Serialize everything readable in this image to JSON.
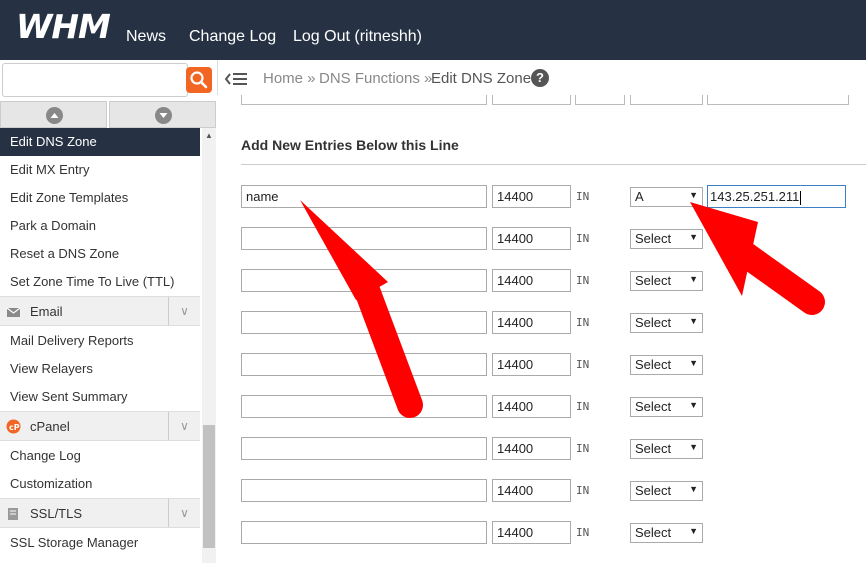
{
  "header": {
    "logo": "WHM",
    "nav": [
      "News",
      "Change Log",
      "Log Out (ritneshh)"
    ]
  },
  "search": {
    "placeholder": ""
  },
  "breadcrumb": [
    "Home »",
    "DNS Functions »",
    "Edit DNS Zone"
  ],
  "sidebar": {
    "dns_items": [
      "Edit DNS Zone",
      "Edit MX Entry",
      "Edit Zone Templates",
      "Park a Domain",
      "Reset a DNS Zone",
      "Set Zone Time To Live (TTL)"
    ],
    "email_header": "Email",
    "email_items": [
      "Mail Delivery Reports",
      "View Relayers",
      "View Sent Summary"
    ],
    "cpanel_header": "cPanel",
    "cpanel_items": [
      "Change Log",
      "Customization"
    ],
    "ssl_header": "SSL/TLS",
    "ssl_items": [
      "SSL Storage Manager"
    ]
  },
  "main": {
    "section_title": "Add New Entries Below this Line",
    "rows": [
      {
        "name": "name",
        "ttl": "14400",
        "class": "IN",
        "type": "A",
        "value": "143.25.251.211"
      },
      {
        "name": "",
        "ttl": "14400",
        "class": "IN",
        "type": "Select"
      },
      {
        "name": "",
        "ttl": "14400",
        "class": "IN",
        "type": "Select"
      },
      {
        "name": "",
        "ttl": "14400",
        "class": "IN",
        "type": "Select"
      },
      {
        "name": "",
        "ttl": "14400",
        "class": "IN",
        "type": "Select"
      },
      {
        "name": "",
        "ttl": "14400",
        "class": "IN",
        "type": "Select"
      },
      {
        "name": "",
        "ttl": "14400",
        "class": "IN",
        "type": "Select"
      },
      {
        "name": "",
        "ttl": "14400",
        "class": "IN",
        "type": "Select"
      },
      {
        "name": "",
        "ttl": "14400",
        "class": "IN",
        "type": "Select"
      }
    ]
  },
  "colors": {
    "topbar": "#263244",
    "search_button": "#f26522",
    "annotation_arrow": "#ff0000"
  }
}
